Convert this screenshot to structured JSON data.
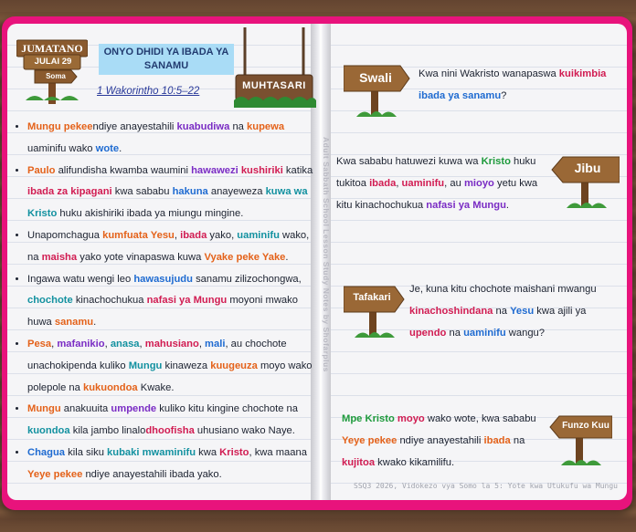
{
  "left": {
    "date_sign": {
      "day": "JUMATANO",
      "date": "JULAI 29",
      "label": "Soma"
    },
    "topic_title": "ONYO DHIDI YA IBADA YA SANAMU",
    "reference": "1 Wakorintho 10:5–22",
    "summary_sign": "MUHTASARI",
    "bullets": [
      [
        [
          "o",
          "Mungu pekee"
        ],
        [
          "",
          "ndiye anayestahili "
        ],
        [
          "p",
          "kuabudiwa"
        ],
        [
          "",
          " na "
        ],
        [
          "o",
          "kupewa"
        ],
        [
          "",
          " uaminifu wako "
        ],
        [
          "b",
          "wote"
        ],
        [
          "",
          "."
        ]
      ],
      [
        [
          "o",
          "Paulo"
        ],
        [
          "",
          " alifundisha kwamba waumini "
        ],
        [
          "p",
          "hawawezi"
        ],
        [
          "",
          " "
        ],
        [
          "r",
          "kushiriki"
        ],
        [
          "",
          " katika "
        ],
        [
          "r",
          "ibada za kipagani"
        ],
        [
          "",
          " kwa sababu "
        ],
        [
          "b",
          "hakuna"
        ],
        [
          "",
          " anayeweza "
        ],
        [
          "t",
          "kuwa wa Kristo"
        ],
        [
          "",
          " huku akishiriki ibada ya miungu mingine."
        ]
      ],
      [
        [
          "",
          "Unapomchagua "
        ],
        [
          "o",
          "kumfuata Yesu"
        ],
        [
          "",
          ", "
        ],
        [
          "r",
          "ibada"
        ],
        [
          "",
          " yako, "
        ],
        [
          "t",
          "uaminifu"
        ],
        [
          "",
          " wako, na "
        ],
        [
          "r",
          "maisha"
        ],
        [
          "",
          " yako yote vinapaswa kuwa "
        ],
        [
          "o",
          "Vyake peke Yake"
        ],
        [
          "",
          "."
        ]
      ],
      [
        [
          "",
          "Ingawa watu wengi leo "
        ],
        [
          "b",
          "hawasujudu"
        ],
        [
          "",
          " sanamu zilizochongwa, "
        ],
        [
          "t",
          "chochote"
        ],
        [
          "",
          " kinachochukua "
        ],
        [
          "r",
          "nafasi ya Mungu"
        ],
        [
          "",
          " moyoni mwako huwa "
        ],
        [
          "o",
          "sanamu"
        ],
        [
          "",
          "."
        ]
      ],
      [
        [
          "o",
          "Pesa"
        ],
        [
          "",
          ", "
        ],
        [
          "p",
          "mafanikio"
        ],
        [
          "",
          ", "
        ],
        [
          "t",
          "anasa"
        ],
        [
          "",
          ", "
        ],
        [
          "r",
          "mahusiano"
        ],
        [
          "",
          ", "
        ],
        [
          "b",
          "mali"
        ],
        [
          "",
          ", au chochote unachokipenda kuliko "
        ],
        [
          "t",
          "Mungu"
        ],
        [
          "",
          " kinaweza "
        ],
        [
          "o",
          "kuugeuza"
        ],
        [
          "",
          " moyo wako polepole na "
        ],
        [
          "o",
          "kukuondoa"
        ],
        [
          "",
          " Kwake."
        ]
      ],
      [
        [
          "o",
          "Mungu"
        ],
        [
          "",
          " anakuuita "
        ],
        [
          "p",
          "umpende"
        ],
        [
          "",
          " kuliko kitu kingine chochote na "
        ],
        [
          "t",
          "kuondoa"
        ],
        [
          "",
          " kila jambo linalo"
        ],
        [
          "r",
          "dhoofisha"
        ],
        [
          "",
          " uhusiano wako Naye."
        ]
      ],
      [
        [
          "b",
          "Chagua"
        ],
        [
          "",
          " kila siku "
        ],
        [
          "t",
          "kubaki mwaminifu"
        ],
        [
          "",
          " kwa "
        ],
        [
          "r",
          "Kristo"
        ],
        [
          "",
          ", kwa maana "
        ],
        [
          "o",
          "Yeye pekee"
        ],
        [
          "",
          " ndiye anayestahili ibada yako."
        ]
      ]
    ]
  },
  "spine_text": "Adult Sabbath School Lesson Study Notes by Shofarplus",
  "right": {
    "swali": {
      "label": "Swali",
      "text": [
        [
          "",
          "Kwa nini Wakristo wanapaswa "
        ],
        [
          "r",
          "kuikimbia"
        ],
        [
          "",
          " "
        ],
        [
          "b",
          "ibada ya sanamu"
        ],
        [
          "",
          "?"
        ]
      ]
    },
    "jibu": {
      "label": "Jibu",
      "text": [
        [
          "",
          "Kwa sababu hatuwezi kuwa wa "
        ],
        [
          "g",
          "Kristo"
        ],
        [
          "",
          " huku tukitoa "
        ],
        [
          "r",
          "ibada"
        ],
        [
          "",
          ", "
        ],
        [
          "r",
          "uaminifu"
        ],
        [
          "",
          ", au "
        ],
        [
          "p",
          "mioyo"
        ],
        [
          "",
          " yetu kwa kitu kinachochukua "
        ],
        [
          "p",
          "nafasi ya Mungu"
        ],
        [
          "",
          "."
        ]
      ]
    },
    "tafakari": {
      "label": "Tafakari",
      "text": [
        [
          "",
          "Je, kuna kitu chochote maishani mwangu "
        ],
        [
          "r",
          "kinachoshindana"
        ],
        [
          "",
          " na "
        ],
        [
          "b",
          "Yesu"
        ],
        [
          "",
          " kwa ajili ya "
        ],
        [
          "r",
          "upendo"
        ],
        [
          "",
          " na "
        ],
        [
          "b",
          "uaminifu"
        ],
        [
          "",
          " wangu?"
        ]
      ]
    },
    "funzo": {
      "label": "Funzo Kuu",
      "text": [
        [
          "g",
          "Mpe Kristo"
        ],
        [
          "",
          " "
        ],
        [
          "r",
          "moyo"
        ],
        [
          "",
          " wako wote, kwa sababu "
        ],
        [
          "o",
          "Yeye pekee"
        ],
        [
          "",
          " ndiye anayestahili "
        ],
        [
          "o",
          "ibada"
        ],
        [
          "",
          " na "
        ],
        [
          "r",
          "kujitoa"
        ],
        [
          "",
          " kwako kikamilifu."
        ]
      ]
    },
    "footer": "SSQ3 2026, Vidokezo vya Somo la 5: Yote kwa Utukufu wa Mungu"
  }
}
